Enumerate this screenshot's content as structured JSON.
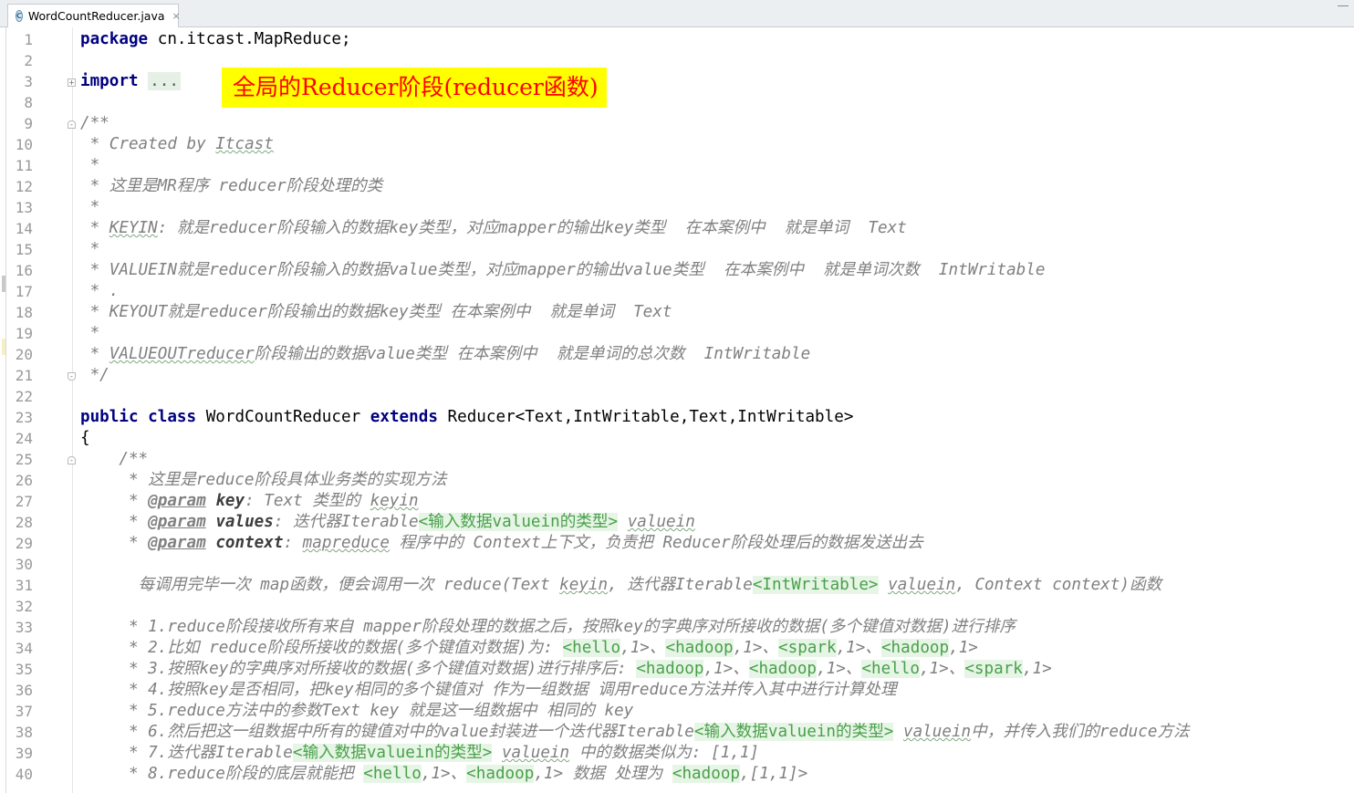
{
  "tab": {
    "filename": "WordCountReducer.java",
    "icon_letter": "C",
    "close_glyph": "×"
  },
  "banner": "全局的Reducer阶段(reducer函数)",
  "line_numbers": [
    "1",
    "2",
    "3",
    "8",
    "9",
    "10",
    "11",
    "12",
    "13",
    "14",
    "15",
    "16",
    "17",
    "18",
    "19",
    "20",
    "21",
    "22",
    "23",
    "24",
    "25",
    "26",
    "27",
    "28",
    "29",
    "30",
    "31",
    "32",
    "33",
    "34",
    "35",
    "36",
    "37",
    "38",
    "39",
    "40"
  ],
  "lines": [
    [
      {
        "t": "kw",
        "v": "package"
      },
      {
        "t": "",
        "v": " cn.itcast.MapReduce;"
      }
    ],
    [],
    [
      {
        "t": "kw",
        "v": "import"
      },
      {
        "t": "",
        "v": " "
      },
      {
        "t": "fold-dots",
        "v": "..."
      }
    ],
    [],
    [
      {
        "t": "cm",
        "v": "/**"
      }
    ],
    [
      {
        "t": "cm",
        "v": " * Created by "
      },
      {
        "t": "cm wavy",
        "v": "Itcast"
      }
    ],
    [
      {
        "t": "cm",
        "v": " *"
      }
    ],
    [
      {
        "t": "cm",
        "v": " * 这里是MR程序 reducer阶段处理的类"
      }
    ],
    [
      {
        "t": "cm",
        "v": " *"
      }
    ],
    [
      {
        "t": "cm",
        "v": " * "
      },
      {
        "t": "cm wavy",
        "v": "KEYIN"
      },
      {
        "t": "cm",
        "v": ": 就是reducer阶段输入的数据key类型，对应mapper的输出key类型  在本案例中  就是单词  Text"
      }
    ],
    [
      {
        "t": "cm",
        "v": " *"
      }
    ],
    [
      {
        "t": "cm",
        "v": " * VALUEIN就是reducer阶段输入的数据value类型，对应mapper的输出value类型  在本案例中  就是单词次数  IntWritable"
      }
    ],
    [
      {
        "t": "cm",
        "v": " * ."
      }
    ],
    [
      {
        "t": "cm",
        "v": " * KEYOUT就是reducer阶段输出的数据key类型 在本案例中  就是单词  Text"
      }
    ],
    [
      {
        "t": "cm",
        "v": " *"
      }
    ],
    [
      {
        "t": "cm",
        "v": " * "
      },
      {
        "t": "cm wavy",
        "v": "VALUEOUTreducer"
      },
      {
        "t": "cm",
        "v": "阶段输出的数据value类型 在本案例中  就是单词的总次数  IntWritable"
      }
    ],
    [
      {
        "t": "cm",
        "v": " */"
      }
    ],
    [],
    [
      {
        "t": "kw",
        "v": "public class"
      },
      {
        "t": "",
        "v": " WordCountReducer "
      },
      {
        "t": "kw",
        "v": "extends"
      },
      {
        "t": "",
        "v": " Reducer<Text,IntWritable,Text,IntWritable>"
      }
    ],
    [
      {
        "t": "",
        "v": "{"
      }
    ],
    [
      {
        "t": "cm",
        "v": "    /**"
      }
    ],
    [
      {
        "t": "cm",
        "v": "     * 这里是reduce阶段具体业务类的实现方法"
      }
    ],
    [
      {
        "t": "cm",
        "v": "     * "
      },
      {
        "t": "tag",
        "v": "@param"
      },
      {
        "t": "cm",
        "v": " "
      },
      {
        "t": "pname",
        "v": "key"
      },
      {
        "t": "cm",
        "v": ": Text 类型的 "
      },
      {
        "t": "cm wavy",
        "v": "keyin"
      }
    ],
    [
      {
        "t": "cm",
        "v": "     * "
      },
      {
        "t": "tag",
        "v": "@param"
      },
      {
        "t": "cm",
        "v": " "
      },
      {
        "t": "pname",
        "v": "values"
      },
      {
        "t": "cm",
        "v": ": 迭代器Iterable"
      },
      {
        "t": "hl",
        "v": "<输入数据valuein的类型>"
      },
      {
        "t": "cm",
        "v": " "
      },
      {
        "t": "cm wavy",
        "v": "valuein"
      }
    ],
    [
      {
        "t": "cm",
        "v": "     * "
      },
      {
        "t": "tag",
        "v": "@param"
      },
      {
        "t": "cm",
        "v": " "
      },
      {
        "t": "pname",
        "v": "context"
      },
      {
        "t": "cm",
        "v": ": "
      },
      {
        "t": "cm wavy",
        "v": "mapreduce"
      },
      {
        "t": "cm",
        "v": " 程序中的 Context上下文，负责把 Reducer阶段处理后的数据发送出去"
      }
    ],
    [],
    [
      {
        "t": "cm",
        "v": "      每调用完毕一次 map函数，便会调用一次 reduce(Text "
      },
      {
        "t": "cm wavy",
        "v": "keyin"
      },
      {
        "t": "cm",
        "v": ", 迭代器Iterable"
      },
      {
        "t": "hl",
        "v": "<IntWritable>"
      },
      {
        "t": "cm",
        "v": " "
      },
      {
        "t": "cm wavy",
        "v": "valuein"
      },
      {
        "t": "cm",
        "v": ", Context context)函数"
      }
    ],
    [],
    [
      {
        "t": "cm",
        "v": "     * 1.reduce阶段接收所有来自 mapper阶段处理的数据之后，按照key的字典序对所接收的数据(多个键值对数据)进行排序"
      }
    ],
    [
      {
        "t": "cm",
        "v": "     * 2.比如 reduce阶段所接收的数据(多个键值对数据)为: "
      },
      {
        "t": "hl",
        "v": "<hello"
      },
      {
        "t": "cm",
        "v": ",1>、"
      },
      {
        "t": "hl",
        "v": "<hadoop"
      },
      {
        "t": "cm",
        "v": ",1>、"
      },
      {
        "t": "hl",
        "v": "<spark"
      },
      {
        "t": "cm",
        "v": ",1>、"
      },
      {
        "t": "hl",
        "v": "<hadoop"
      },
      {
        "t": "cm",
        "v": ",1>"
      }
    ],
    [
      {
        "t": "cm",
        "v": "     * 3.按照key的字典序对所接收的数据(多个键值对数据)进行排序后: "
      },
      {
        "t": "hl",
        "v": "<hadoop"
      },
      {
        "t": "cm",
        "v": ",1>、"
      },
      {
        "t": "hl",
        "v": "<hadoop"
      },
      {
        "t": "cm",
        "v": ",1>、"
      },
      {
        "t": "hl",
        "v": "<hello"
      },
      {
        "t": "cm",
        "v": ",1>、"
      },
      {
        "t": "hl",
        "v": "<spark"
      },
      {
        "t": "cm",
        "v": ",1>"
      }
    ],
    [
      {
        "t": "cm",
        "v": "     * 4.按照key是否相同，把key相同的多个键值对 作为一组数据 调用reduce方法并传入其中进行计算处理"
      }
    ],
    [
      {
        "t": "cm",
        "v": "     * 5.reduce方法中的参数Text key 就是这一组数据中 相同的 key"
      }
    ],
    [
      {
        "t": "cm",
        "v": "     * 6.然后把这一组数据中所有的键值对中的value封装进一个迭代器Iterable"
      },
      {
        "t": "hl",
        "v": "<输入数据valuein的类型>"
      },
      {
        "t": "cm",
        "v": " "
      },
      {
        "t": "cm wavy",
        "v": "valuein"
      },
      {
        "t": "cm",
        "v": "中，并传入我们的reduce方法"
      }
    ],
    [
      {
        "t": "cm",
        "v": "     * 7.迭代器Iterable"
      },
      {
        "t": "hl",
        "v": "<输入数据valuein的类型>"
      },
      {
        "t": "cm",
        "v": " "
      },
      {
        "t": "cm wavy",
        "v": "valuein"
      },
      {
        "t": "cm",
        "v": " 中的数据类似为: [1,1]"
      }
    ],
    [
      {
        "t": "cm",
        "v": "     * 8.reduce阶段的底层就能把 "
      },
      {
        "t": "hl",
        "v": "<hello"
      },
      {
        "t": "cm",
        "v": ",1>、"
      },
      {
        "t": "hl",
        "v": "<hadoop"
      },
      {
        "t": "cm",
        "v": ",1> 数据 处理为 "
      },
      {
        "t": "hl",
        "v": "<hadoop"
      },
      {
        "t": "cm",
        "v": ",[1,1]>"
      }
    ]
  ]
}
